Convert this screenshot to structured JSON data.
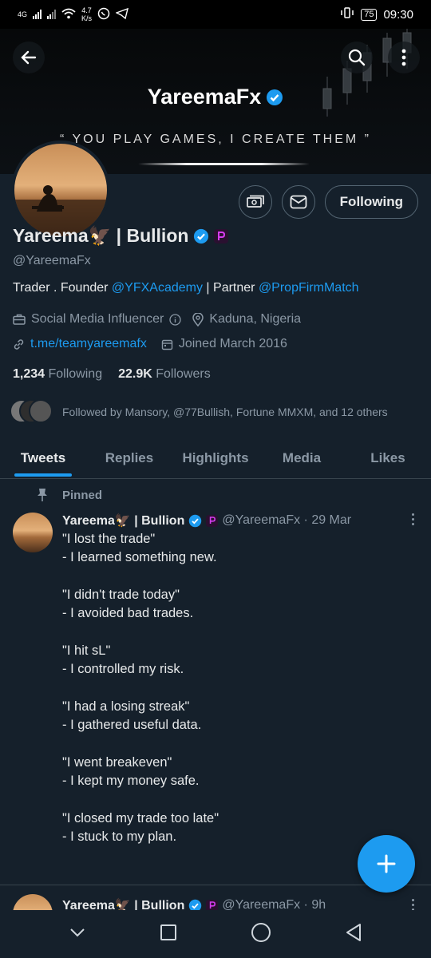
{
  "status": {
    "net": "4G",
    "speed": "4.7",
    "speed_unit": "K/s",
    "battery": "75",
    "time": "09:30"
  },
  "banner": {
    "title": "YareemaFx",
    "quote": "“ YOU PLAY GAMES, I CREATE THEM ”"
  },
  "profile": {
    "name": "Yareema🦅 | Bullion",
    "handle": "@YareemaFx",
    "bio_prefix": "Trader . Founder ",
    "bio_link1": "@YFXAcademy",
    "bio_mid": " | Partner ",
    "bio_link2": "@PropFirmMatch",
    "category": "Social Media Influencer",
    "location": "Kaduna, Nigeria",
    "website": "t.me/teamyareemafx",
    "joined": "Joined March 2016",
    "following_count": "1,234",
    "following_label": "Following",
    "followers_count": "22.9K",
    "followers_label": "Followers",
    "followed_by": "Followed by Mansory, @77Bullish, Fortune MMXM, and 12 others",
    "follow_button": "Following"
  },
  "tabs": [
    "Tweets",
    "Replies",
    "Highlights",
    "Media",
    "Likes"
  ],
  "pinned_label": "Pinned",
  "tweet1": {
    "name": "Yareema🦅 | Bullion",
    "handle_date": "@YareemaFx · 29 Mar",
    "paragraphs": [
      [
        "\"I lost the trade\"",
        "- I learned something new."
      ],
      [
        "\"I didn't trade today\"",
        "- I avoided bad trades."
      ],
      [
        "\"I hit sL\"",
        "- I controlled my risk."
      ],
      [
        "\"I had a losing streak\"",
        "- I gathered useful data."
      ],
      [
        "\"I went breakeven\"",
        "- I kept my money safe."
      ],
      [
        "\"I closed my trade too late\"",
        "- I stuck to my plan."
      ]
    ]
  },
  "tweet2": {
    "name": "Yareema🦅 | Bullion",
    "handle_date": "@YareemaFx · 9h"
  },
  "colors": {
    "accent": "#1d9bf0",
    "background": "#15202b",
    "muted": "#8b98a5"
  }
}
